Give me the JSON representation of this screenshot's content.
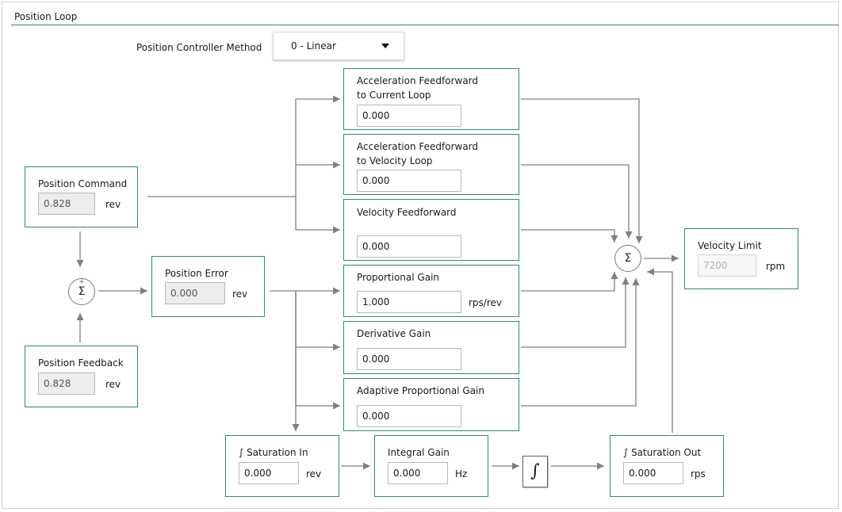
{
  "section": {
    "title": "Position Loop"
  },
  "method": {
    "label": "Position Controller Method",
    "value": "0 - Linear"
  },
  "blocks": {
    "accel_ff_current": {
      "label": "Acceleration Feedforward\nto Current Loop",
      "value": "0.000",
      "unit": ""
    },
    "accel_ff_velocity": {
      "label": "Acceleration Feedforward\nto Velocity Loop",
      "value": "0.000",
      "unit": ""
    },
    "velocity_ff": {
      "label": "Velocity Feedforward",
      "value": "0.000",
      "unit": ""
    },
    "position_command": {
      "label": "Position Command",
      "value": "0.828",
      "unit": "rev"
    },
    "position_error": {
      "label": "Position Error",
      "value": "0.000",
      "unit": "rev"
    },
    "position_feedback": {
      "label": "Position Feedback",
      "value": "0.828",
      "unit": "rev"
    },
    "proportional_gain": {
      "label": "Proportional Gain",
      "value": "1.000",
      "unit": "rps/rev"
    },
    "derivative_gain": {
      "label": "Derivative Gain",
      "value": "0.000",
      "unit": ""
    },
    "adaptive_gain": {
      "label": "Adaptive Proportional Gain",
      "value": "0.000",
      "unit": ""
    },
    "velocity_limit": {
      "label": "Velocity Limit",
      "value": "7200",
      "unit": "rpm"
    },
    "saturation_in": {
      "label": "∫ Saturation In",
      "value": "0.000",
      "unit": "rev"
    },
    "integral_gain": {
      "label": "Integral Gain",
      "value": "0.000",
      "unit": "Hz"
    },
    "saturation_out": {
      "label": "∫ Saturation Out",
      "value": "0.000",
      "unit": "rps"
    }
  },
  "summers": {
    "error_sum": {
      "symbol": "Σ",
      "plus": "+",
      "minus": "-"
    },
    "output_sum": {
      "symbol": "Σ"
    }
  },
  "integrator": {
    "icon": "integral-icon",
    "symbol": "∫"
  },
  "colors": {
    "accent": "#2e8b6e",
    "wire": "#7f7f7f"
  }
}
